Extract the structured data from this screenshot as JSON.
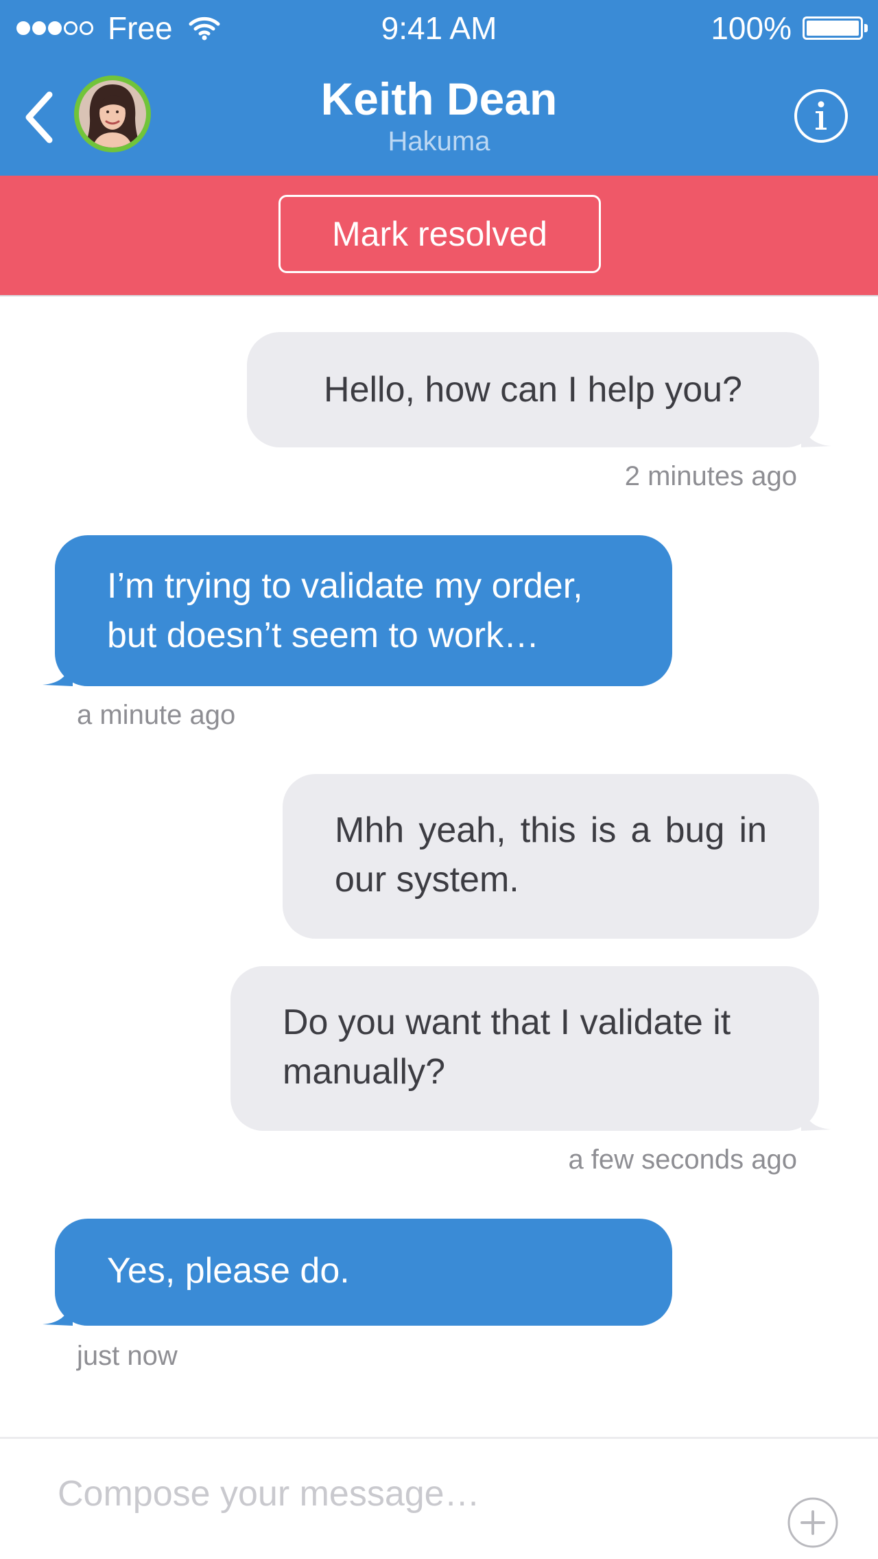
{
  "status_bar": {
    "carrier": "Free",
    "time": "9:41 AM",
    "battery": "100%",
    "signal_bars_filled": 3,
    "signal_bars_total": 5
  },
  "header": {
    "title": "Keith Dean",
    "subtitle": "Hakuma",
    "back_icon": "chevron-left-icon",
    "info_icon": "info-icon"
  },
  "banner": {
    "button_label": "Mark resolved"
  },
  "messages": [
    {
      "direction": "outgoing",
      "text": "Hello, how can I help you?",
      "time": "2 minutes ago"
    },
    {
      "direction": "incoming",
      "text": "I’m trying to validate my order, but doesn’t seem to work…",
      "time": "a minute ago"
    },
    {
      "direction": "outgoing",
      "text": "Mhh yeah, this is a bug in our system.",
      "time": ""
    },
    {
      "direction": "outgoing",
      "text": "Do you want that I validate it manually?",
      "time": "a few seconds ago"
    },
    {
      "direction": "incoming",
      "text": "Yes, please do.",
      "time": "just now"
    }
  ],
  "compose": {
    "placeholder": "Compose your message…",
    "add_icon": "plus-circle-icon"
  },
  "colors": {
    "header": "#3a8bd6",
    "banner": "#ef5868",
    "incoming_bubble": "#3a8bd6",
    "outgoing_bubble": "#ebebef",
    "avatar_ring": "#71c43a"
  }
}
